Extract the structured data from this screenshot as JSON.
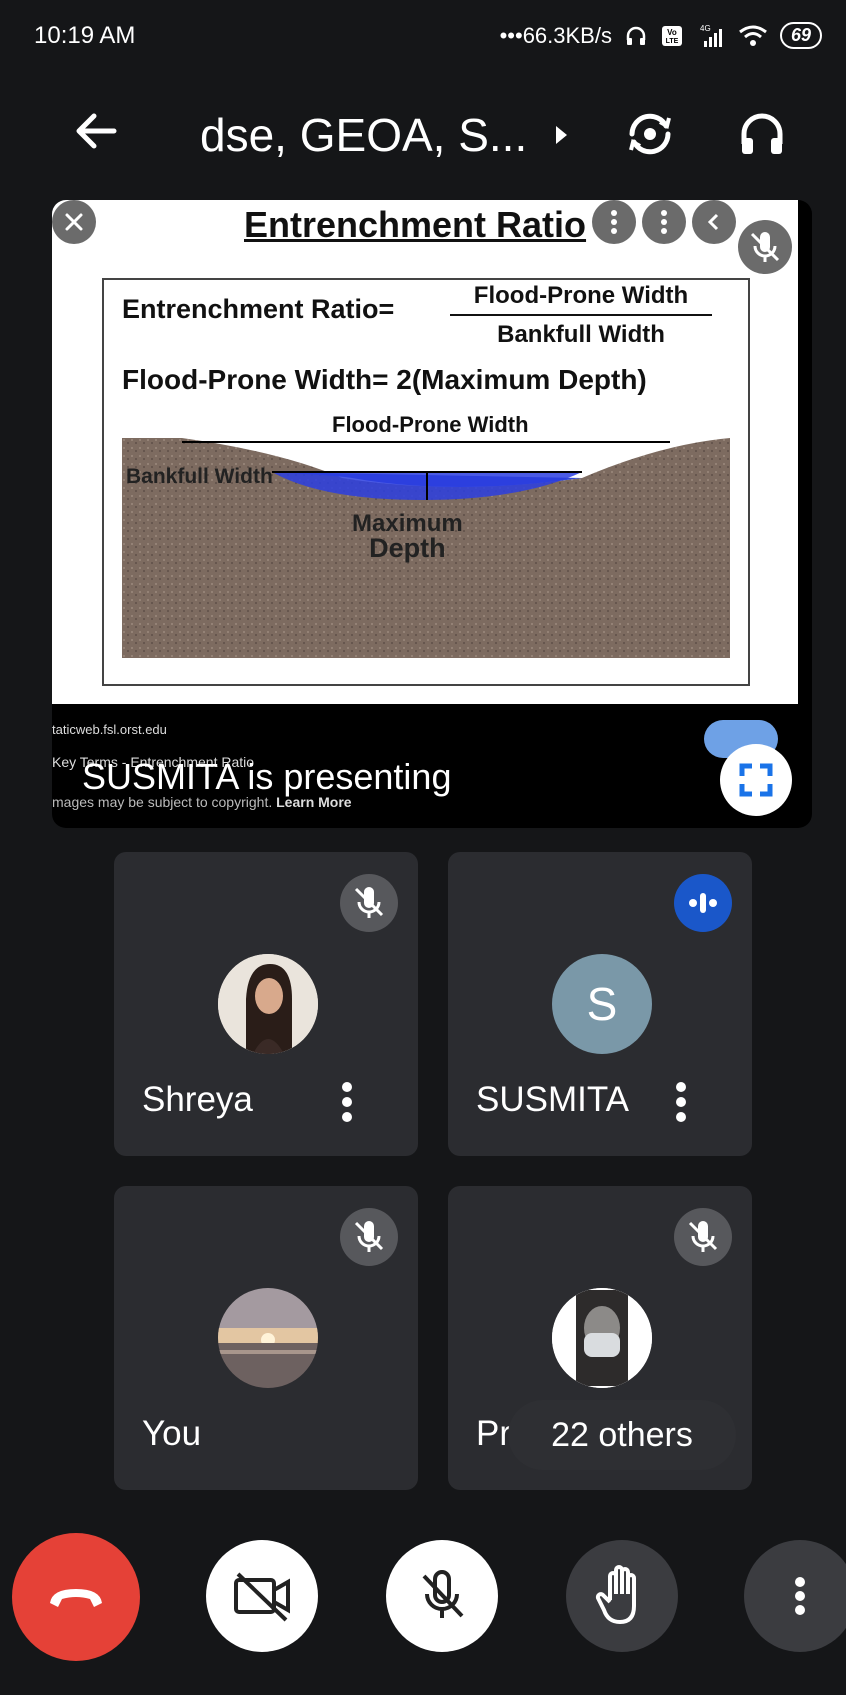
{
  "status_bar": {
    "time": "10:19 AM",
    "network_speed": "66.3KB/s",
    "battery": "69",
    "network_type": "4G",
    "volte": "Vo LTE"
  },
  "app_bar": {
    "title": "dse, GEOA, S..."
  },
  "presentation": {
    "slide": {
      "title": "Entrenchment Ratio",
      "equation_label": "Entrenchment Ratio=",
      "fraction_numerator": "Flood-Prone Width",
      "fraction_denominator": "Bankfull Width",
      "equation2": "Flood-Prone Width= 2(Maximum Depth)",
      "diagram_top_label": "Flood-Prone Width",
      "diagram_left_label": "Bankfull Width",
      "diagram_center_label_1": "Maximum",
      "diagram_center_label_2": "Depth"
    },
    "source_url": "taticweb.fsl.orst.edu",
    "key_terms": "Key Terms - Entrenchment Ratio",
    "copyright_text": "mages may be subject to copyright.",
    "learn_more": "Learn More",
    "presenting_text": "SUSMITA is presenting"
  },
  "participants": [
    {
      "name": "Shreya",
      "muted": true,
      "avatar": "photo"
    },
    {
      "name": "SUSMITA",
      "muted": false,
      "speaking": true,
      "avatar_letter": "S"
    },
    {
      "name": "You",
      "muted": true,
      "avatar": "photo"
    },
    {
      "name": "Pre",
      "muted": true,
      "avatar": "photo"
    }
  ],
  "others_count_label": "22 others",
  "colors": {
    "background": "#151618",
    "tile": "#2b2c30",
    "end_call": "#e54137",
    "speaking_accent": "#1a57c9"
  },
  "icons": {
    "back": "arrow-left-icon",
    "switch_camera": "switch-camera-icon",
    "audio": "headphones-icon",
    "end_call": "phone-hangup-icon",
    "camera_off": "video-off-icon",
    "mic_off": "mic-off-icon",
    "hand": "raise-hand-icon",
    "more": "more-vert-icon",
    "fullscreen": "fullscreen-icon"
  }
}
